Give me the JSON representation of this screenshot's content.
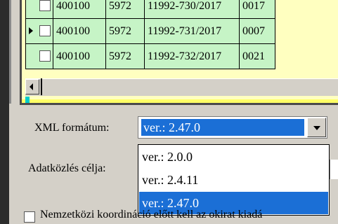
{
  "grid": {
    "rows": [
      {
        "current": false,
        "col1": "400100",
        "col2": "5972",
        "col3": "11992-730/2017",
        "col4": "0017"
      },
      {
        "current": true,
        "col1": "400100",
        "col2": "5972",
        "col3": "11992-731/2017",
        "col4": "0007"
      },
      {
        "current": false,
        "col1": "400100",
        "col2": "5972",
        "col3": "11992-732/2017",
        "col4": "0021"
      }
    ]
  },
  "xml_format": {
    "label": "XML formátum:",
    "selected": "ver.: 2.47.0",
    "options": [
      "ver.: 2.0.0",
      "ver.: 2.4.11",
      "ver.: 2.47.0"
    ]
  },
  "purpose": {
    "label": "Adatközlés célja:"
  },
  "intl_coordination": {
    "label": "Nemzetközi koordináció előtt kell az okirat kiadá"
  },
  "colors": {
    "selection": "#1b6fd6",
    "grid_cell": "#c6f4c6",
    "grid_bg": "#ffffc0"
  }
}
